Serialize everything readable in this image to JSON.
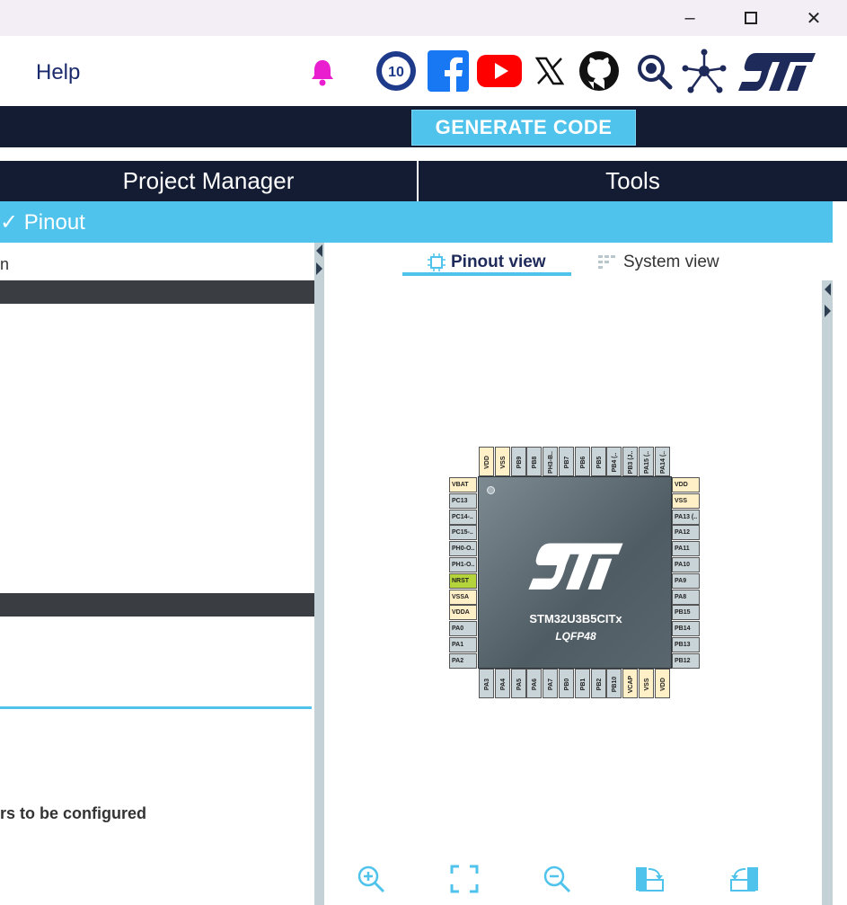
{
  "window": {
    "minimize": "–",
    "maximize": "☐",
    "close": "✕"
  },
  "menu": {
    "help": "Help"
  },
  "social": [
    "10-year-badge-icon",
    "facebook-icon",
    "youtube-icon",
    "x-icon",
    "github-icon",
    "search-community-icon",
    "network-icon",
    "st-logo"
  ],
  "toolbar": {
    "generate": "GENERATE CODE"
  },
  "tabs": {
    "project_manager": "Project Manager",
    "tools": "Tools"
  },
  "subtab": {
    "label": "✓ Pinout"
  },
  "left": {
    "cut_text": "n",
    "bottom_text": "rs to be configured"
  },
  "views": {
    "pinout": "Pinout view",
    "system": "System view"
  },
  "chip": {
    "name": "STM32U3B5CITx",
    "package": "LQFP48",
    "left_pins": [
      "VBAT",
      "PC13",
      "PC14-..",
      "PC15-..",
      "PH0-O..",
      "PH1-O..",
      "NRST",
      "VSSA",
      "VDDA",
      "PA0",
      "PA1",
      "PA2"
    ],
    "right_pins": [
      "VDD",
      "VSS",
      "PA13 (..",
      "PA12",
      "PA11",
      "PA10",
      "PA9",
      "PA8",
      "PB15",
      "PB14",
      "PB13",
      "PB12"
    ],
    "top_pins": [
      "VDD",
      "VSS",
      "PB9",
      "PB8",
      "PH3-B..",
      "PB7",
      "PB6",
      "PB5",
      "PB4 (..",
      "PB3 (J..",
      "PA15 (..",
      "PA14 (.."
    ],
    "bottom_pins": [
      "PA3",
      "PA4",
      "PA5",
      "PA6",
      "PA7",
      "PB0",
      "PB1",
      "PB2",
      "PB10",
      "VCAP",
      "VSS",
      "VDD"
    ],
    "power_pins": [
      "VDD",
      "VSS",
      "VBAT",
      "VSSA",
      "VDDA",
      "VCAP"
    ],
    "reset_pin": "NRST"
  },
  "colors": {
    "dark": "#141c33",
    "accent": "#4fc3ec",
    "pin_default": "#c9d4d9",
    "pin_power": "#fff0c8",
    "pin_reset": "#b5d33a"
  },
  "tools": [
    "zoom-in-icon",
    "fit-screen-icon",
    "zoom-out-icon",
    "rotate-right-icon",
    "rotate-left-icon"
  ]
}
